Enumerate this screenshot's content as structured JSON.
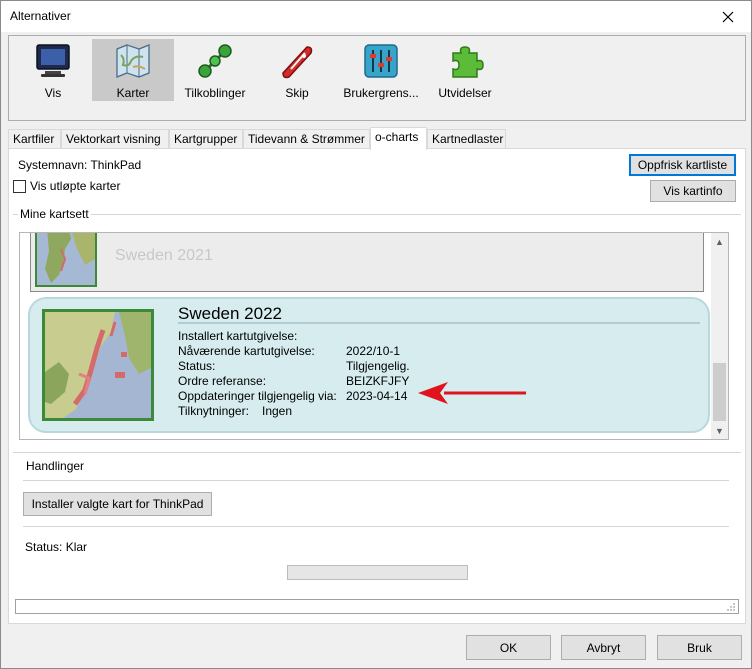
{
  "window": {
    "title": "Alternativer"
  },
  "toolbar": {
    "items": [
      {
        "label": "Vis",
        "icon": "monitor-icon"
      },
      {
        "label": "Karter",
        "icon": "map-icon",
        "selected": true
      },
      {
        "label": "Tilkoblinger",
        "icon": "connections-icon"
      },
      {
        "label": "Skip",
        "icon": "boat-icon"
      },
      {
        "label": "Brukergrens...",
        "icon": "sliders-icon"
      },
      {
        "label": "Utvidelser",
        "icon": "puzzle-icon"
      }
    ]
  },
  "tabs": [
    {
      "label": "Kartfiler"
    },
    {
      "label": "Vektorkart visning"
    },
    {
      "label": "Kartgrupper"
    },
    {
      "label": "Tidevann & Strømmer"
    },
    {
      "label": "o-charts",
      "active": true
    },
    {
      "label": "Kartnedlaster"
    }
  ],
  "ocharts": {
    "system_name": "Systemnavn: ThinkPad",
    "show_expired_label": "Vis utløpte karter",
    "show_expired_checked": false,
    "refresh_button": "Oppfrisk kartliste",
    "info_button": "Vis kartinfo",
    "my_chartsets_label": "Mine kartsett",
    "chartsets": [
      {
        "title": "Sweden 2021"
      },
      {
        "title": "Sweden 2022",
        "fields": [
          {
            "label": "Installert kartutgivelse:",
            "value": ""
          },
          {
            "label": "Nåværende kartutgivelse:",
            "value": "2022/10-1"
          },
          {
            "label": "Status:",
            "value": "Tilgjengelig."
          },
          {
            "label": "Ordre referanse:",
            "value": "BEIZKFJFY"
          },
          {
            "label": "Oppdateringer tilgjengelig via:",
            "value": "2023-04-14"
          }
        ],
        "links_label": "Tilknytninger:",
        "links_value": "Ingen"
      }
    ],
    "actions_label": "Handlinger",
    "install_button": "Installer valgte kart for ThinkPad",
    "status": "Status: Klar",
    "progress": 0
  },
  "footer": {
    "ok": "OK",
    "cancel": "Avbryt",
    "apply": "Bruk"
  },
  "colors": {
    "selected_card": "#d6ecef",
    "annotation_arrow": "#e0141e",
    "chart_frame": "#3a8a3a"
  }
}
